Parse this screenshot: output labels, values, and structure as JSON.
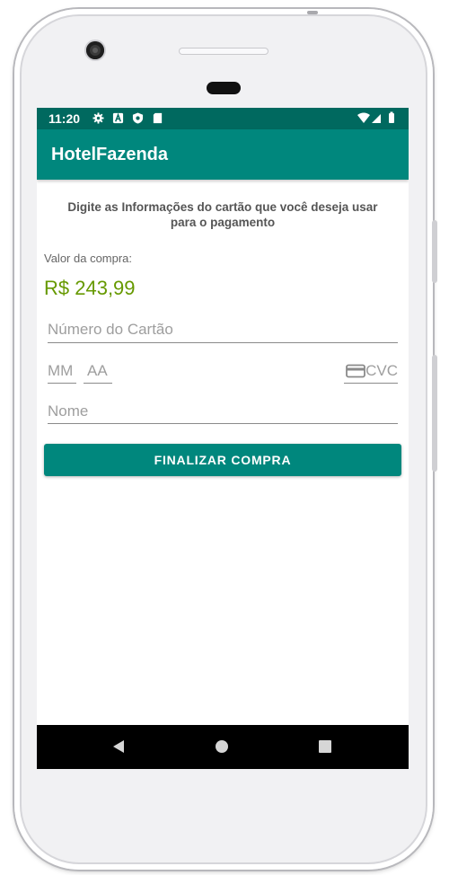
{
  "status_bar": {
    "time": "11:20",
    "icons": [
      "gear-icon",
      "a-icon",
      "shield-icon",
      "sd-card-icon"
    ],
    "right_icons": [
      "wifi-icon",
      "signal-icon",
      "battery-icon"
    ]
  },
  "app_bar": {
    "title": "HotelFazenda"
  },
  "form": {
    "instruction": "Digite as Informações do cartão que você deseja usar para o pagamento",
    "valor_label": "Valor da compra:",
    "valor_value": "R$ 243,99",
    "card_number_placeholder": "Número do Cartão",
    "month_placeholder": "MM",
    "year_placeholder": "AA",
    "cvc_placeholder": "CVC",
    "name_placeholder": "Nome",
    "submit_label": "FINALIZAR COMPRA"
  },
  "nav_bar": {
    "buttons": [
      "back-icon",
      "home-icon",
      "recents-icon"
    ]
  },
  "colors": {
    "primary": "#00877d",
    "primary_dark": "#00695f",
    "price": "#669900"
  }
}
